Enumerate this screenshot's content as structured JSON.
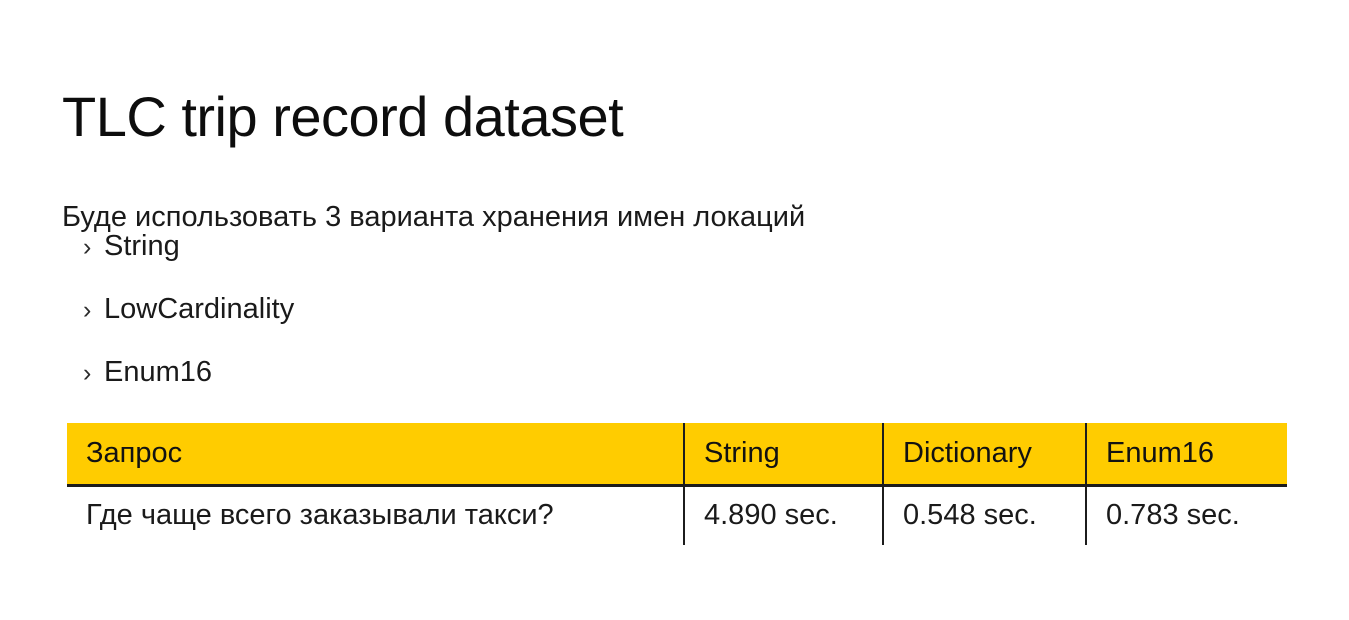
{
  "slide": {
    "title": "TLC trip record dataset",
    "subtitle": "Буде использовать 3 варианта хранения имен локаций",
    "bullet_marker": "›",
    "bullets": [
      {
        "label": "String"
      },
      {
        "label": "LowCardinality"
      },
      {
        "label": "Enum16"
      }
    ],
    "colors": {
      "accent": "#FFCC00",
      "text": "#1A1A1A",
      "border": "#1C1C1C",
      "background": "#FFFFFF"
    }
  },
  "table": {
    "headers": [
      "Запрос",
      "String",
      "Dictionary",
      "Enum16"
    ],
    "rows": [
      {
        "query": "Где чаще всего заказывали такси?",
        "string": "4.890 sec.",
        "dictionary": "0.548 sec.",
        "enum16": "0.783 sec."
      }
    ]
  }
}
